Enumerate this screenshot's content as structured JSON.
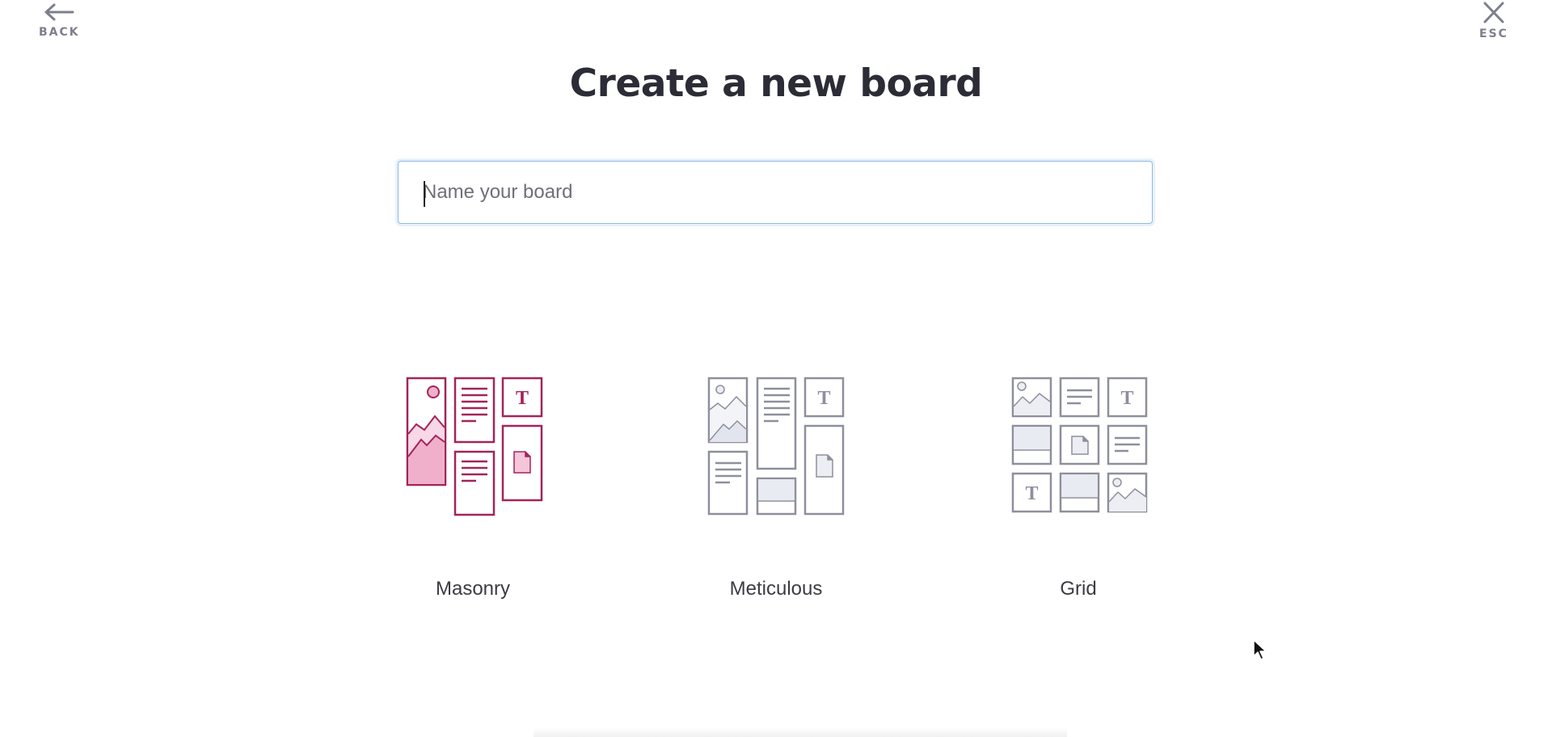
{
  "nav": {
    "back_label": "BACK",
    "back_icon": "arrow-left-icon",
    "esc_label": "ESC",
    "esc_icon": "close-icon"
  },
  "header": {
    "title": "Create a new board"
  },
  "name_input": {
    "value": "",
    "placeholder": "Name your board"
  },
  "layouts": [
    {
      "label": "Masonry",
      "selected": true,
      "accent_color": "#a3245a",
      "fill_color": "#f2b3cf"
    },
    {
      "label": "Meticulous",
      "selected": false,
      "accent_color": "#8e8f9c",
      "fill_color": "#e8e9f2"
    },
    {
      "label": "Grid",
      "selected": false,
      "accent_color": "#8e8f9c",
      "fill_color": "#e8e9f2"
    }
  ],
  "colors": {
    "title": "#2b2c35",
    "nav": "#7d7f8e",
    "input_focus_border": "#8ebbe6"
  }
}
